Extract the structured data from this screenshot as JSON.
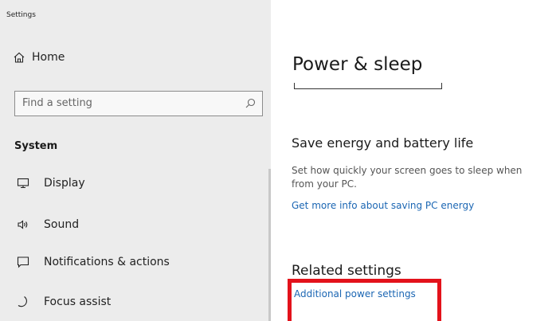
{
  "window": {
    "title": "Settings"
  },
  "sidebar": {
    "home_label": "Home",
    "search": {
      "placeholder": "Find a setting"
    },
    "section": "System",
    "items": [
      {
        "label": "Display",
        "icon": "monitor-icon"
      },
      {
        "label": "Sound",
        "icon": "speaker-icon"
      },
      {
        "label": "Notifications & actions",
        "icon": "notification-icon"
      },
      {
        "label": "Focus assist",
        "icon": "moon-icon"
      }
    ]
  },
  "main": {
    "title": "Power & sleep",
    "save_section": {
      "heading": "Save energy and battery life",
      "description_line1": "Set how quickly your screen goes to sleep when",
      "description_line2": "from your PC.",
      "link": "Get more info about saving PC energy"
    },
    "related": {
      "heading": "Related settings",
      "link": "Additional power settings"
    }
  },
  "colors": {
    "accent_link": "#1b66b3",
    "sidebar_bg": "#ececec",
    "highlight": "#e3121b"
  }
}
